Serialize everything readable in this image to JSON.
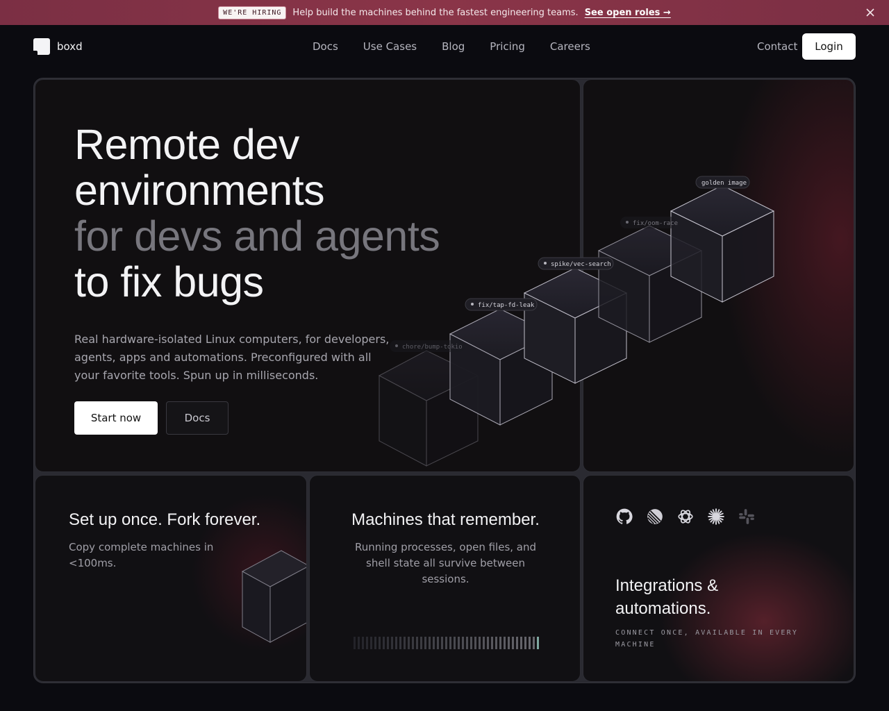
{
  "banner": {
    "badge": "WE'RE HIRING",
    "message": "Help build the machines behind the fastest engineering teams.",
    "link": "See open roles →"
  },
  "nav": {
    "brand": "boxd",
    "links": [
      "Docs",
      "Use Cases",
      "Blog",
      "Pricing",
      "Careers"
    ],
    "contact": "Contact",
    "login": "Login"
  },
  "hero": {
    "title_line1": "Remote dev",
    "title_line2": "environments",
    "title_line3": "for devs and agents",
    "title_line4": "to fix bugs",
    "subtitle": "Real hardware-isolated Linux computers, for developers, agents, apps and automations. Preconfigured with all your favorite tools. Spun up in milliseconds.",
    "cta_primary": "Start now",
    "cta_secondary": "Docs"
  },
  "branches": [
    "golden image",
    "fix/oom-race",
    "spike/vec-search",
    "fix/tap-fd-leak",
    "chore/bump-tokio"
  ],
  "features": {
    "fork": {
      "title": "Set up once. Fork forever.",
      "desc": "Copy complete machines in <100ms."
    },
    "remember": {
      "title": "Machines that remember.",
      "desc": "Running processes, open files, and shell state all survive between sessions."
    },
    "integrations": {
      "title": "Integrations & automations.",
      "tagline": "CONNECT ONCE, AVAILABLE IN EVERY MACHINE",
      "icons": [
        "github-icon",
        "linear-icon",
        "openai-icon",
        "claude-icon",
        "slack-icon"
      ]
    }
  },
  "colors": {
    "banner": "#7b2f44",
    "background": "#0b0b10",
    "accent_glow": "#8c2d3c"
  }
}
